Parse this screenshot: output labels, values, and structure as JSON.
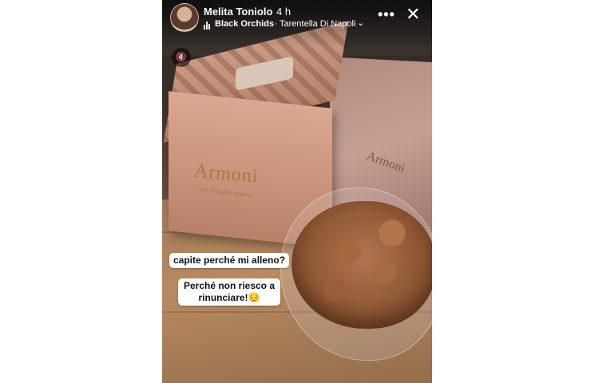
{
  "header": {
    "username": "Melita Toniolo",
    "time_ago": "4 h",
    "music_song": "Black Orchids",
    "music_separator": "·",
    "music_artist": "Tarentella Di Napoli",
    "chevron_icon": "chevron-down-icon",
    "more_icon": "•••",
    "close_icon": "✕"
  },
  "controls": {
    "mute_icon": "🔇"
  },
  "photo": {
    "box_brand": "Armoni",
    "box_subtitle": "Chef Massimo Armoni",
    "right_box_brand": "Armoni"
  },
  "stickers": {
    "line1": "capite perché mi alleno?",
    "line2": "Perché non riesco a rinunciare!😔"
  }
}
